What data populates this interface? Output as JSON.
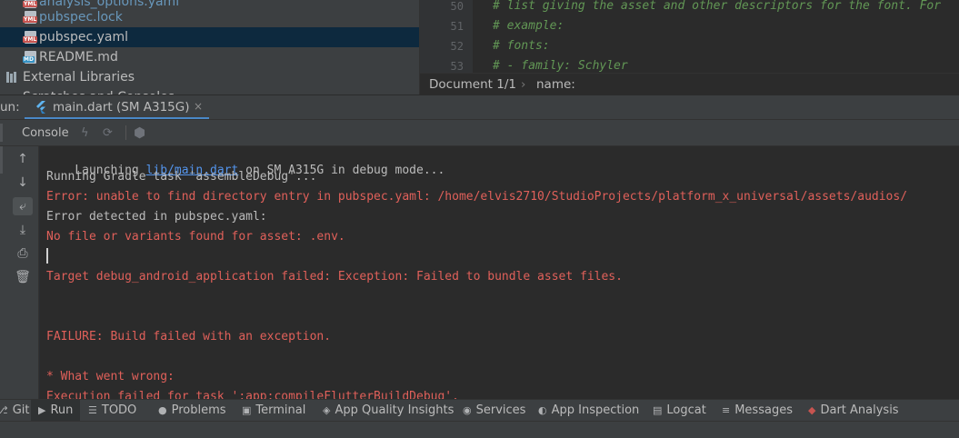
{
  "project_tree": {
    "items": [
      {
        "label": "analysis_options.yaml",
        "tag": "YML",
        "modified": true
      },
      {
        "label": "pubspec.lock",
        "tag": "YML",
        "modified": true
      },
      {
        "label": "pubspec.yaml",
        "tag": "YML",
        "modified": false,
        "selected": true
      },
      {
        "label": "README.md",
        "tag": "MD",
        "modified": false
      },
      {
        "label": "External Libraries"
      },
      {
        "label": "Scratches and Consoles"
      }
    ]
  },
  "editor": {
    "lines": [
      {
        "number": "50",
        "text": "# list giving the asset and other descriptors for the font. For"
      },
      {
        "number": "51",
        "text": "# example:"
      },
      {
        "number": "52",
        "text": "# fonts:"
      },
      {
        "number": "53",
        "text": "#   - family: Schyler"
      }
    ],
    "breadcrumb": {
      "document": "Document 1/1",
      "separator": "›",
      "key": "name:"
    }
  },
  "run_window": {
    "label": "un:",
    "tab_label": "main.dart (SM A315G)",
    "close_glyph": "×",
    "console_tab": "Console"
  },
  "console": {
    "lines": [
      {
        "pre": "Launching ",
        "link": "lib/main.dart",
        "post": " on SM A315G in debug mode...",
        "error": false
      },
      {
        "text": "Running Gradle task 'assembleDebug'...",
        "error": false
      },
      {
        "text": "Error: unable to find directory entry in pubspec.yaml: /home/elvis2710/StudioProjects/platform_x_universal/assets/audios/",
        "error": true
      },
      {
        "text": "Error detected in pubspec.yaml:",
        "error": false
      },
      {
        "text": "No file or variants found for asset: .env.",
        "error": true
      },
      {
        "text": "Target debug_android_application failed: Exception: Failed to bundle asset files.",
        "error": true
      },
      {
        "text": "FAILURE: Build failed with an exception.",
        "error": true
      },
      {
        "text": "* What went wrong:",
        "error": true
      },
      {
        "text": "Execution failed for task ':app:compileFlutterBuildDebug'.",
        "error": true
      }
    ]
  },
  "bottom_tools": [
    {
      "label": "Git",
      "icon": "git-icon"
    },
    {
      "label": "Run",
      "icon": "play-icon",
      "active": true
    },
    {
      "label": "TODO",
      "icon": "todo-list-icon"
    },
    {
      "label": "Problems",
      "icon": "info-icon"
    },
    {
      "label": "Terminal",
      "icon": "terminal-icon"
    },
    {
      "label": "App Quality Insights",
      "icon": "shield-icon"
    },
    {
      "label": "Services",
      "icon": "services-icon"
    },
    {
      "label": "App Inspection",
      "icon": "inspection-icon"
    },
    {
      "label": "Logcat",
      "icon": "logcat-icon"
    },
    {
      "label": "Messages",
      "icon": "messages-icon"
    },
    {
      "label": "Dart Analysis",
      "icon": "dart-icon"
    }
  ],
  "colors": {
    "error_text": "#e0605a",
    "link": "#5394ec",
    "comment": "#629755",
    "accent": "#4a88c7"
  }
}
